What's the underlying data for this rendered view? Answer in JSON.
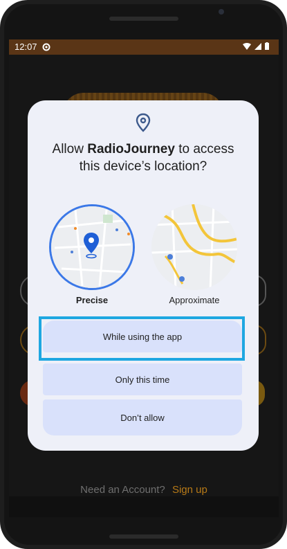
{
  "statusbar": {
    "time": "12:07"
  },
  "dialog": {
    "title_prefix": "Allow ",
    "app_name": "RadioJourney",
    "title_suffix": " to access this device’s location?",
    "precise_label": "Precise",
    "approximate_label": "Approximate",
    "buttons": {
      "while_using": "While using the app",
      "only_this_time": "Only this time",
      "dont_allow": "Don’t allow"
    }
  },
  "background": {
    "account_prompt": "Need an Account?",
    "signup": "Sign up"
  },
  "colors": {
    "accent_blue": "#3b78e7",
    "highlight": "#1ea7e1",
    "statusbar": "#5a3516",
    "button_fill": "#d9e1fb"
  }
}
